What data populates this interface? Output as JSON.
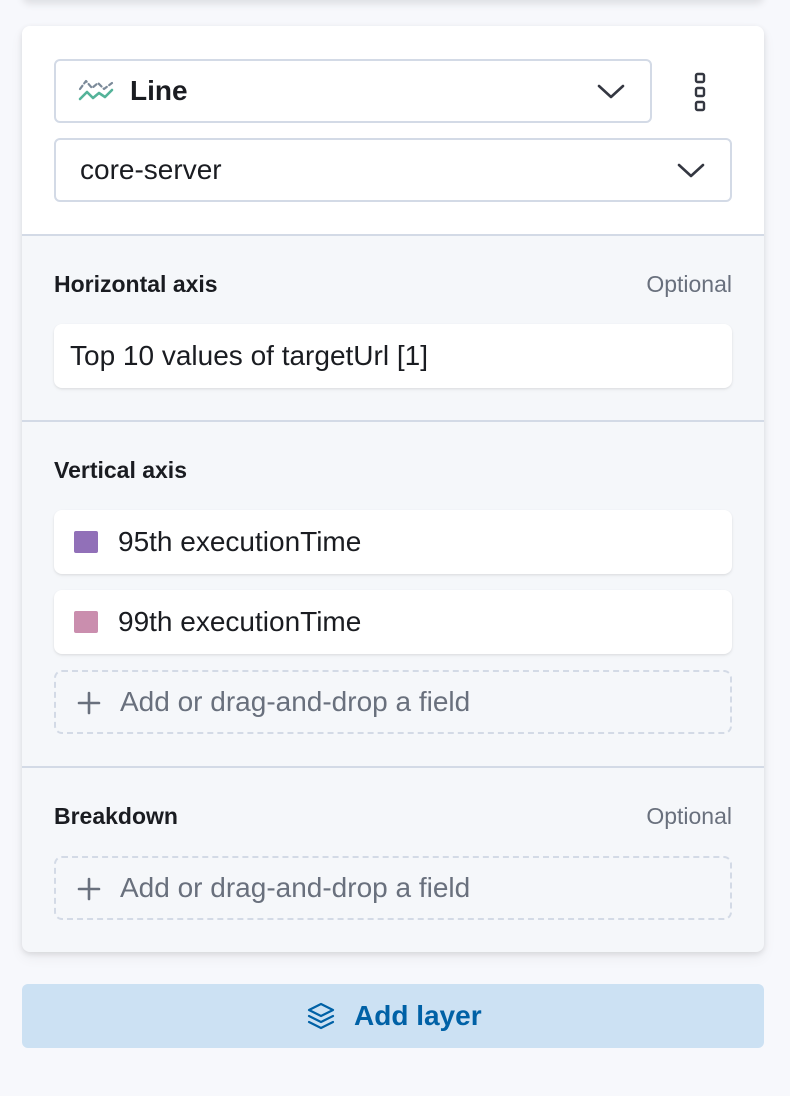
{
  "layer": {
    "chart_type": {
      "label": "Line",
      "icon": "line-chart-icon"
    },
    "index_pattern": {
      "label": "core-server"
    },
    "menu_icon": "vertical-ellipsis-icon"
  },
  "horizontal_axis": {
    "title": "Horizontal axis",
    "optional": "Optional",
    "value": "Top 10 values of targetUrl [1]"
  },
  "vertical_axis": {
    "title": "Vertical axis",
    "items": [
      {
        "label": "95th executionTime",
        "color": "#9170b8"
      },
      {
        "label": "99th executionTime",
        "color": "#ca8eae"
      }
    ],
    "empty_slot": "Add or drag-and-drop a field"
  },
  "breakdown": {
    "title": "Breakdown",
    "optional": "Optional",
    "empty_slot": "Add or drag-and-drop a field"
  },
  "add_layer": {
    "label": "Add layer",
    "icon": "layers-icon"
  },
  "colors": {
    "accent": "#0061a6",
    "add_layer_bg": "#cce1f3",
    "border": "#d3dae6",
    "subdued_text": "#69707d"
  }
}
